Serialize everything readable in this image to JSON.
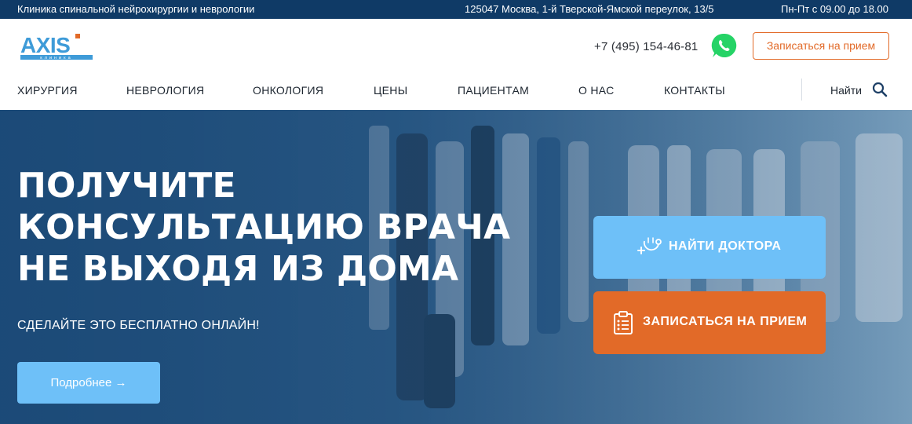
{
  "topbar": {
    "clinic_name": "Клиника спинальной нейрохирургии и неврологии",
    "address": "125047 Москва, 1-й Тверской-Ямской переулок, 13/5",
    "hours": "Пн-Пт с 09.00 до 18.00"
  },
  "header": {
    "logo_text": "AXIS",
    "logo_subtext": "клиника",
    "phone": "+7 (495) 154-46-81",
    "whatsapp_icon": "whatsapp-icon",
    "book_button": "Записаться на прием"
  },
  "nav": {
    "items": [
      {
        "label": "ХИРУРГИЯ"
      },
      {
        "label": "НЕВРОЛОГИЯ"
      },
      {
        "label": "ОНКОЛОГИЯ"
      },
      {
        "label": "ЦЕНЫ"
      },
      {
        "label": "ПАЦИЕНТАМ"
      },
      {
        "label": "О НАС"
      },
      {
        "label": "КОНТАКТЫ"
      }
    ],
    "search_label": "Найти",
    "search_icon": "search-icon"
  },
  "hero": {
    "title_lines": [
      "ПОЛУЧИТЕ",
      "КОНСУЛЬТАЦИЮ ВРАЧА",
      "НЕ ВЫХОДЯ ИЗ ДОМА"
    ],
    "subtitle": "СДЕЛАЙТЕ ЭТО БЕСПЛАТНО ОНЛАЙН!",
    "more_button": "Подробнее →",
    "find_doctor": "НАЙТИ ДОКТОРА",
    "find_doctor_icon": "stethoscope-icon",
    "book": "ЗАПИСАТЬСЯ НА ПРИЕМ",
    "book_icon": "clipboard-icon"
  },
  "colors": {
    "topbar": "#0f3a66",
    "accent_blue": "#6ec0f8",
    "accent_orange": "#e26a28",
    "whatsapp": "#25d366"
  }
}
